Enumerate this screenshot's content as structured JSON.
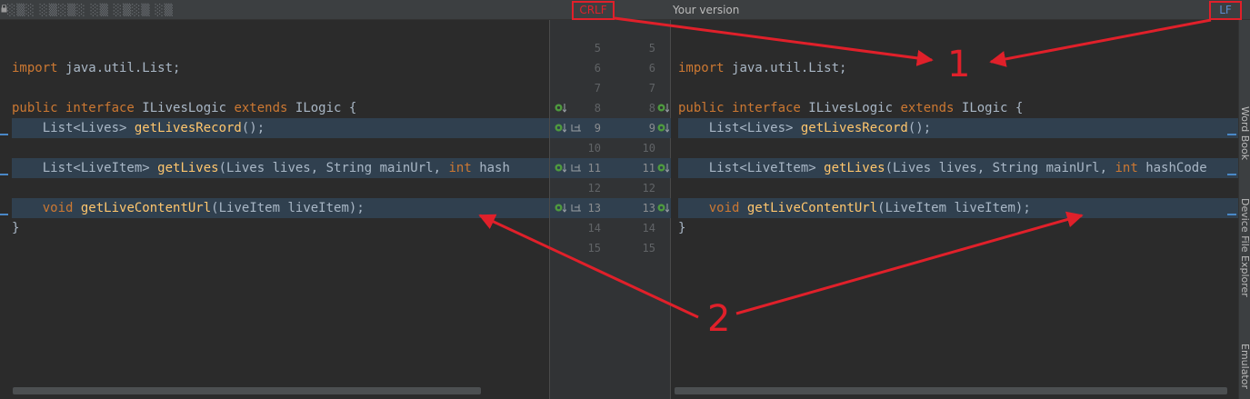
{
  "header": {
    "left_title": "░▒░ ░▒░▒░ ░▒ ░▒░▒ ░▒",
    "left_line_separator": "CRLF",
    "right_title": "Your version",
    "right_line_separator": "LF"
  },
  "left_code": {
    "line_import": [
      {
        "t": "import ",
        "c": "kw"
      },
      {
        "t": "java.util.List;",
        "c": "txt"
      }
    ],
    "line_interface": [
      {
        "t": "public interface ",
        "c": "kw"
      },
      {
        "t": "ILivesLogic ",
        "c": "txt"
      },
      {
        "t": "extends ",
        "c": "kw"
      },
      {
        "t": "ILogic {",
        "c": "txt"
      }
    ],
    "line_9": [
      {
        "t": "    List<Lives> ",
        "c": "txt"
      },
      {
        "t": "getLivesRecord",
        "c": "fn"
      },
      {
        "t": "();",
        "c": "txt"
      }
    ],
    "line_11": [
      {
        "t": "    List<LiveItem> ",
        "c": "txt"
      },
      {
        "t": "getLives",
        "c": "fn"
      },
      {
        "t": "(Lives lives, String mainUrl, ",
        "c": "txt"
      },
      {
        "t": "int ",
        "c": "kw"
      },
      {
        "t": "hash",
        "c": "txt"
      }
    ],
    "line_13": [
      {
        "t": "    ",
        "c": "txt"
      },
      {
        "t": "void ",
        "c": "kw"
      },
      {
        "t": "getLiveContentUrl",
        "c": "fn"
      },
      {
        "t": "(LiveItem liveItem);",
        "c": "txt"
      }
    ],
    "line_close": [
      {
        "t": "}",
        "c": "txt"
      }
    ]
  },
  "right_code": {
    "line_import": [
      {
        "t": "import ",
        "c": "kw"
      },
      {
        "t": "java.util.List;",
        "c": "txt"
      }
    ],
    "line_interface": [
      {
        "t": "public interface ",
        "c": "kw"
      },
      {
        "t": "ILivesLogic ",
        "c": "txt"
      },
      {
        "t": "extends ",
        "c": "kw"
      },
      {
        "t": "ILogic {",
        "c": "txt"
      }
    ],
    "line_9": [
      {
        "t": "    List<Lives> ",
        "c": "txt"
      },
      {
        "t": "getLivesRecord",
        "c": "fn"
      },
      {
        "t": "();",
        "c": "txt"
      }
    ],
    "line_11": [
      {
        "t": "    List<LiveItem> ",
        "c": "txt"
      },
      {
        "t": "getLives",
        "c": "fn"
      },
      {
        "t": "(Lives lives, String mainUrl, ",
        "c": "txt"
      },
      {
        "t": "int ",
        "c": "kw"
      },
      {
        "t": "hashCode",
        "c": "txt"
      }
    ],
    "line_13": [
      {
        "t": "    ",
        "c": "txt"
      },
      {
        "t": "void ",
        "c": "kw"
      },
      {
        "t": "getLiveContentUrl",
        "c": "fn"
      },
      {
        "t": "(LiveItem liveItem);",
        "c": "txt"
      }
    ],
    "line_close": [
      {
        "t": "}",
        "c": "txt"
      }
    ]
  },
  "gutter": {
    "l5": "5",
    "r5": "5",
    "l6": "6",
    "r6": "6",
    "l7": "7",
    "r7": "7",
    "l8": "8",
    "r8": "8",
    "l9": "9",
    "r9": "9",
    "l10": "10",
    "r10": "10",
    "l11": "11",
    "r11": "11",
    "l12": "12",
    "r12": "12",
    "l13": "13",
    "r13": "13",
    "l14": "14",
    "r14": "14",
    "l15": "15",
    "r15": "15"
  },
  "side_tools": {
    "word_book": "Word Book",
    "device_file_explorer": "Device File Explorer",
    "emulator": "Emulator"
  },
  "annotations": {
    "label_1": "1",
    "label_2": "2"
  },
  "colors": {
    "annotation_red": "#e0202a",
    "changed_line_bg": "#30404f",
    "keyword": "#cc7832",
    "method": "#ffc66d",
    "plain_text": "#a9b7c6",
    "change_marker": "#4a88c7"
  }
}
